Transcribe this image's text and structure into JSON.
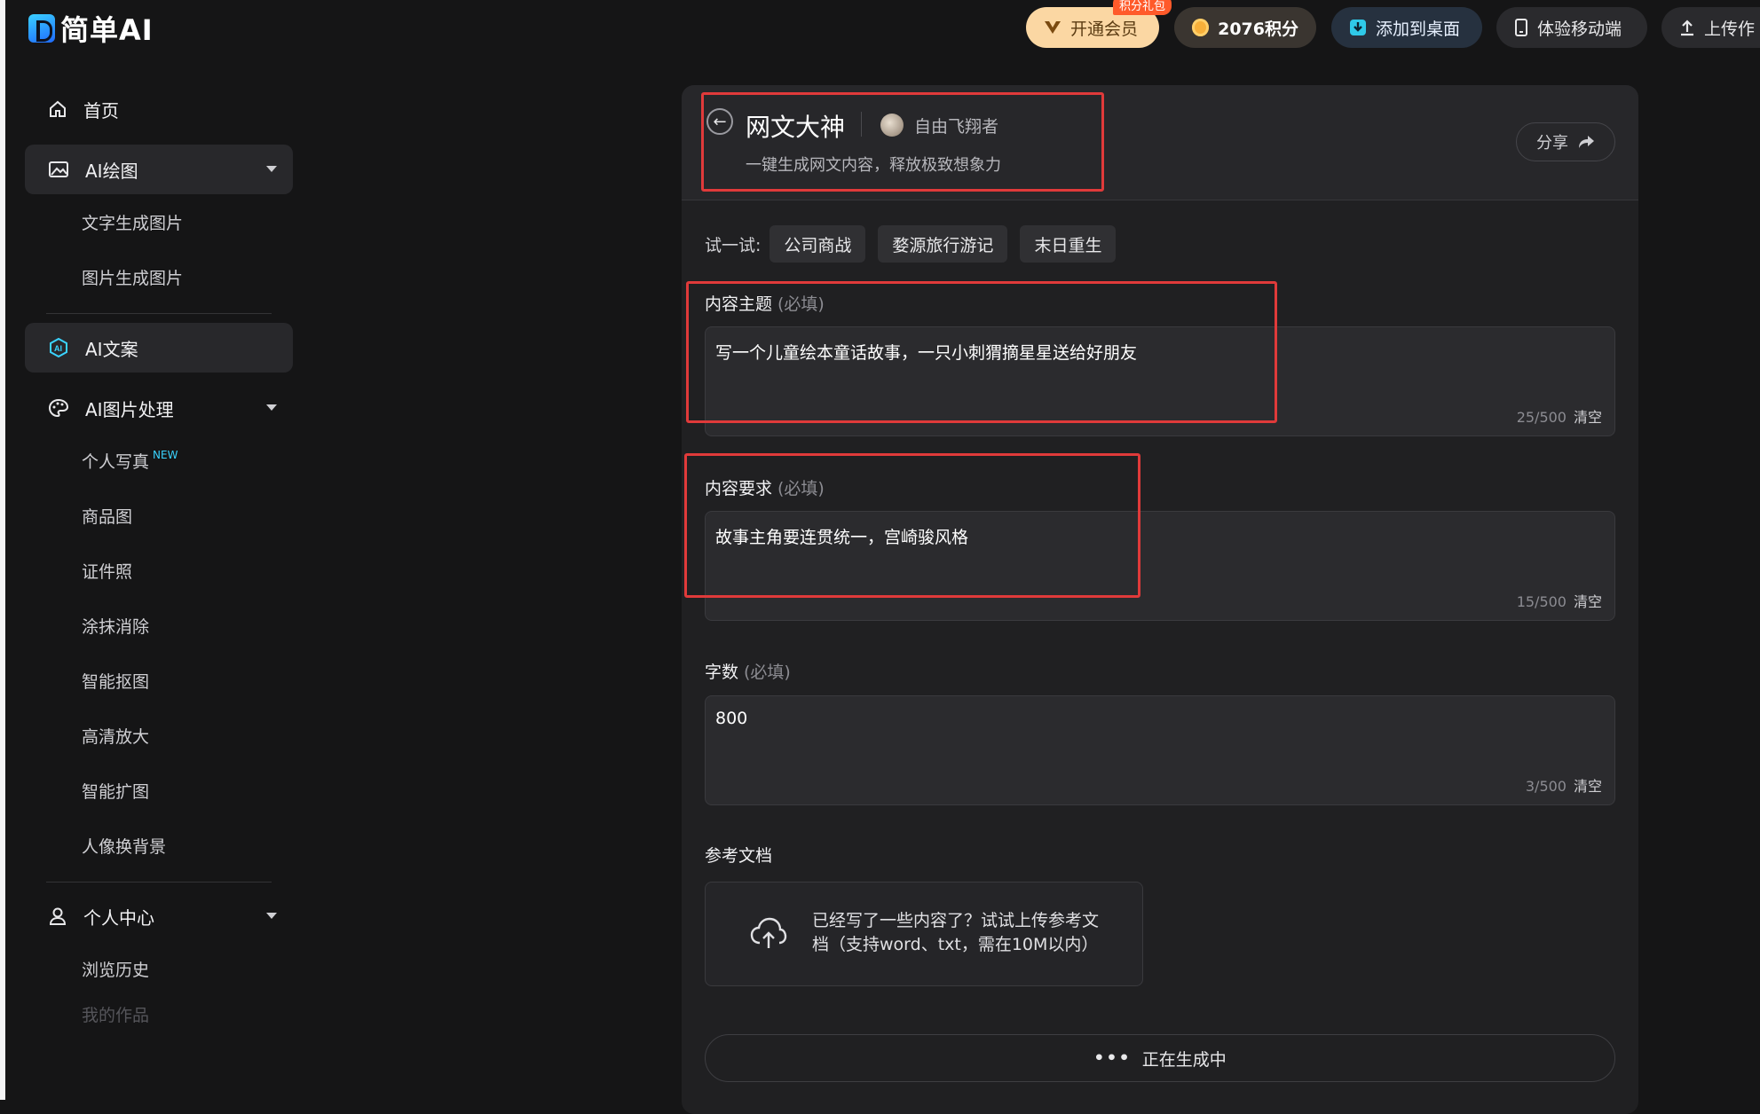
{
  "brand": {
    "name": "简单AI"
  },
  "topbar": {
    "vip_label": "开通会员",
    "vip_badge": "积分礼包",
    "points_label": "2076积分",
    "add_desktop_label": "添加到桌面",
    "mobile_label": "体验移动端",
    "upload_label": "上传作"
  },
  "sidebar": {
    "home": "首页",
    "ai_draw": "AI绘图",
    "text_to_image": "文字生成图片",
    "image_to_image": "图片生成图片",
    "ai_copy": "AI文案",
    "ai_image_process": "AI图片处理",
    "portrait": "个人写真",
    "portrait_badge": "NEW",
    "product_image": "商品图",
    "id_photo": "证件照",
    "erase": "涂抹消除",
    "cutout": "智能抠图",
    "upscale": "高清放大",
    "expand": "智能扩图",
    "bg_swap": "人像换背景",
    "user_center": "个人中心",
    "history": "浏览历史",
    "my_works": "我的作品"
  },
  "panel": {
    "title": "网文大神",
    "author": "自由飞翔者",
    "subtitle": "一键生成网文内容，释放极致想象力",
    "share_label": "分享",
    "try_label": "试一试:",
    "examples": [
      "公司商战",
      "婺源旅行游记",
      "末日重生"
    ],
    "fields": [
      {
        "label": "内容主题",
        "required": "(必填)",
        "value": "写一个儿童绘本童话故事，一只小刺猬摘星星送给好朋友",
        "count": "25/500",
        "clear": "清空"
      },
      {
        "label": "内容要求",
        "required": "(必填)",
        "value": "故事主角要连贯统一，宫崎骏风格",
        "count": "15/500",
        "clear": "清空"
      },
      {
        "label": "字数",
        "required": "(必填)",
        "value": "800",
        "count": "3/500",
        "clear": "清空"
      }
    ],
    "reference_label": "参考文档",
    "upload_hint": "已经写了一些内容了？试试上传参考文档（支持word、txt，需在10M以内）",
    "generating_label": "正在生成中",
    "generating_dots": "•••"
  },
  "colors": {
    "annotation": "#e03a3a",
    "accent": "#3ad3ff",
    "vip": "#fbd7a3"
  }
}
